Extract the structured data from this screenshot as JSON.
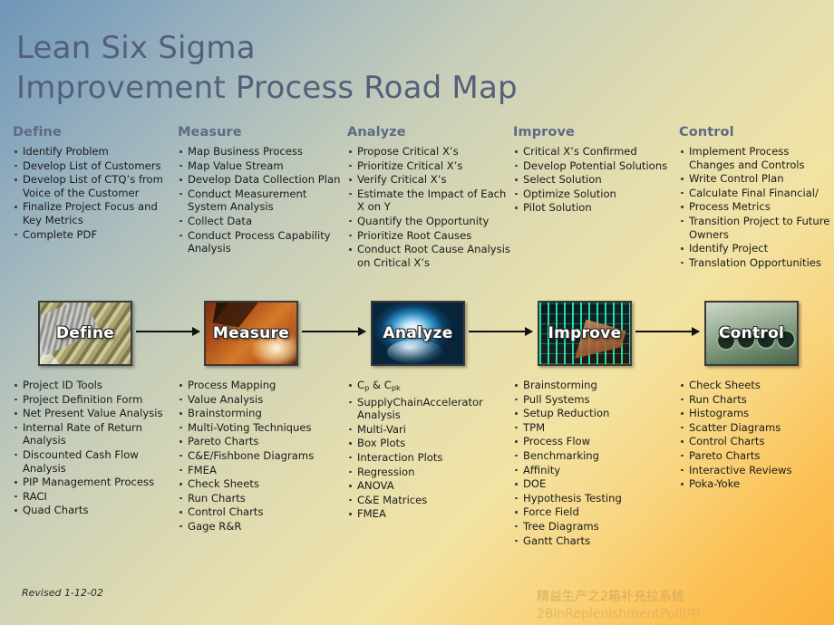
{
  "slide": {
    "title": "Lean Six Sigma\nImprovement Process Road Map",
    "revised": "Revised 1-12-02",
    "watermark_line1": "精益生产之2箱补充拉系统",
    "watermark_line2": "2BinReplenishmentPull(中",
    "colors": {
      "title_text": "#53607a",
      "heading_text": "#5d6a85",
      "body_text": "#1b1b1b",
      "background_start": "#6e96b8",
      "background_mid": "#d8d7b4",
      "background_end": "#fbb03c",
      "arrow": "#111111",
      "box_label": "#ffffff",
      "watermark": "#c9a24a"
    }
  },
  "phases": [
    {
      "key": "define",
      "heading": "Define",
      "box_label": "Define",
      "box_image": "book-binding-photo",
      "deliverables": [
        "Identify Problem",
        "Develop List of Customers",
        "Develop List of CTQ’s from Voice of the Customer",
        "Finalize Project Focus and Key Metrics",
        "Complete PDF"
      ],
      "tools": [
        "Project ID Tools",
        "Project Definition Form",
        "Net Present Value Analysis",
        "Internal Rate of Return Analysis",
        "Discounted Cash Flow Analysis",
        "PIP Management Process",
        "RACI",
        "Quad Charts"
      ]
    },
    {
      "key": "measure",
      "heading": "Measure",
      "box_label": "Measure",
      "box_image": "caliper-measuring-photo",
      "deliverables": [
        "Map Business Process",
        "Map Value Stream",
        "Develop Data Collection Plan",
        "Conduct Measurement System Analysis",
        "Collect Data",
        "Conduct Process Capability Analysis"
      ],
      "tools": [
        "Process Mapping",
        "Value Analysis",
        "Brainstorming",
        "Multi-Voting Techniques",
        "Pareto Charts",
        "C&E/Fishbone Diagrams",
        "FMEA",
        "Check Sheets",
        "Run Charts",
        "Control Charts",
        "Gage R&R"
      ]
    },
    {
      "key": "analyze",
      "heading": "Analyze",
      "box_label": "Analyze",
      "box_image": "water-droplet-photo",
      "deliverables": [
        "Propose Critical X’s",
        "Prioritize Critical X’s",
        "Verify Critical X’s",
        "Estimate the Impact of Each X on Y",
        "Quantify the Opportunity",
        "Prioritize Root Causes",
        "Conduct Root Cause Analysis on Critical X’s"
      ],
      "tools": [
        "Cp & Cpk",
        "SupplyChainAccelerator Analysis",
        "Multi-Vari",
        "Box Plots",
        "Interaction Plots",
        "Regression",
        "ANOVA",
        "C&E Matrices",
        "FMEA"
      ],
      "tools_html": [
        "C<sub>p</sub> & C<sub>pk</sub>"
      ]
    },
    {
      "key": "improve",
      "heading": "Improve",
      "box_label": "Improve",
      "box_image": "circuit-board-photo",
      "deliverables": [
        "Critical X’s Confirmed",
        "Develop Potential Solutions",
        "Select Solution",
        "Optimize Solution",
        "Pilot Solution"
      ],
      "tools": [
        "Brainstorming",
        "Pull Systems",
        "Setup Reduction",
        "TPM",
        "Process Flow",
        "Benchmarking",
        "Affinity",
        "DOE",
        "Hypothesis Testing",
        "Force Field",
        "Tree Diagrams",
        "Gantt Charts"
      ]
    },
    {
      "key": "control",
      "heading": "Control",
      "box_label": "Control",
      "box_image": "gauges-dials-photo",
      "deliverables": [
        "Implement Process Changes and Controls",
        "Write Control Plan",
        "Calculate Final Financial/",
        "Process Metrics",
        "Transition Project to Future Owners",
        "Identify Project",
        "Translation Opportunities"
      ],
      "tools": [
        "Check Sheets",
        "Run Charts",
        "Histograms",
        "Scatter Diagrams",
        "Control Charts",
        "Pareto Charts",
        "Interactive Reviews",
        "Poka-Yoke"
      ]
    }
  ],
  "flow": {
    "arrow_count": 4,
    "direction": "left-to-right"
  }
}
